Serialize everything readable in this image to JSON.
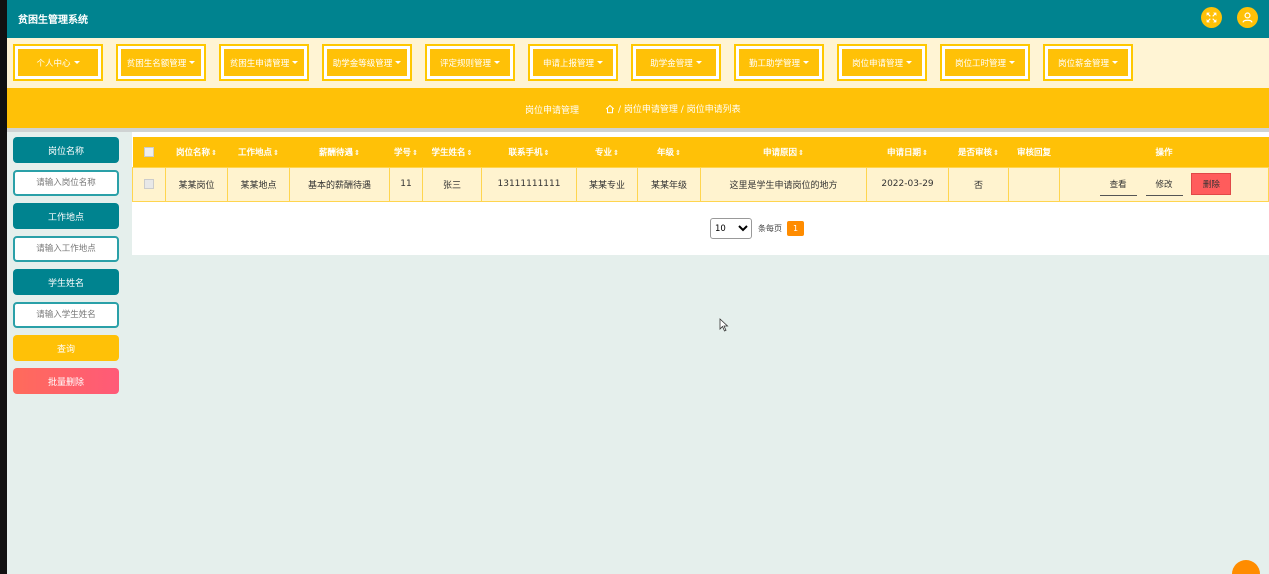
{
  "app": {
    "title": "贫困生管理系统"
  },
  "header_icons": [
    "fullscreen-icon",
    "user-icon"
  ],
  "nav": [
    "个人中心",
    "贫困生名额管理",
    "贫困生申请管理",
    "助学金等级管理",
    "评定规则管理",
    "申请上报管理",
    "助学金管理",
    "勤工助学管理",
    "岗位申请管理",
    "岗位工时管理",
    "岗位薪金管理"
  ],
  "breadcrumb": {
    "title": "岗位申请管理",
    "path": "/ 岗位申请管理 / 岗位申请列表"
  },
  "search": {
    "field1_label": "岗位名称",
    "field1_placeholder": "请输入岗位名称",
    "field2_label": "工作地点",
    "field2_placeholder": "请输入工作地点",
    "field3_label": "学生姓名",
    "field3_placeholder": "请输入学生姓名",
    "query_button": "查询",
    "bulk_delete_button": "批量删除"
  },
  "table": {
    "columns": [
      "岗位名称",
      "工作地点",
      "薪酬待遇",
      "学号",
      "学生姓名",
      "联系手机",
      "专业",
      "年级",
      "申请原因",
      "申请日期",
      "是否审核",
      "审核回复",
      "操作"
    ],
    "sort_glyph": "⇕",
    "rows": [
      {
        "job_name": "某某岗位",
        "location": "某某地点",
        "salary": "基本的薪酬待遇",
        "student_id": "11",
        "student_name": "张三",
        "phone": "13111111111",
        "major": "某某专业",
        "grade": "某某年级",
        "reason": "这里是学生申请岗位的地方",
        "date": "2022-03-29",
        "reviewed": "否",
        "reply": ""
      }
    ],
    "actions": {
      "view": "查看",
      "edit": "修改",
      "delete": "删除"
    }
  },
  "pagination": {
    "page_size": "10",
    "per_page_label": "条每页",
    "current_page": "1"
  },
  "colors": {
    "header": "#00838f",
    "accent": "#ffc107",
    "danger": "#ff5c5c",
    "page": "#ff8c00"
  }
}
